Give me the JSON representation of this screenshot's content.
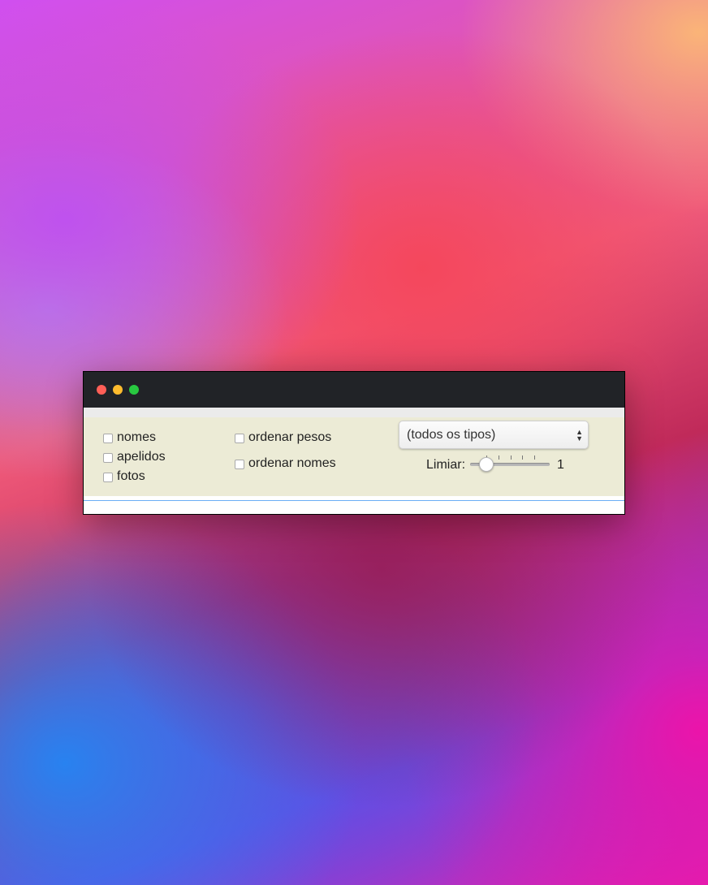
{
  "window": {
    "controls": [
      "close",
      "minimize",
      "zoom"
    ]
  },
  "options": {
    "checkboxes_left": [
      {
        "label": "nomes",
        "checked": false
      },
      {
        "label": "apelidos",
        "checked": false
      },
      {
        "label": "fotos",
        "checked": false
      }
    ],
    "checkboxes_middle": [
      {
        "label": "ordenar pesos",
        "checked": false
      },
      {
        "label": "ordenar nomes",
        "checked": false
      }
    ]
  },
  "type_select": {
    "value": "(todos os tipos)",
    "arrows_icon": "up-down-chevron-icon"
  },
  "threshold": {
    "label": "Limiar:",
    "value": "1",
    "min": 0,
    "max": 5,
    "current": 1,
    "tick_count": 5
  },
  "colors": {
    "panel_background": "#ecebd6",
    "titlebar": "#212327",
    "accent_line": "#6aaef5"
  }
}
